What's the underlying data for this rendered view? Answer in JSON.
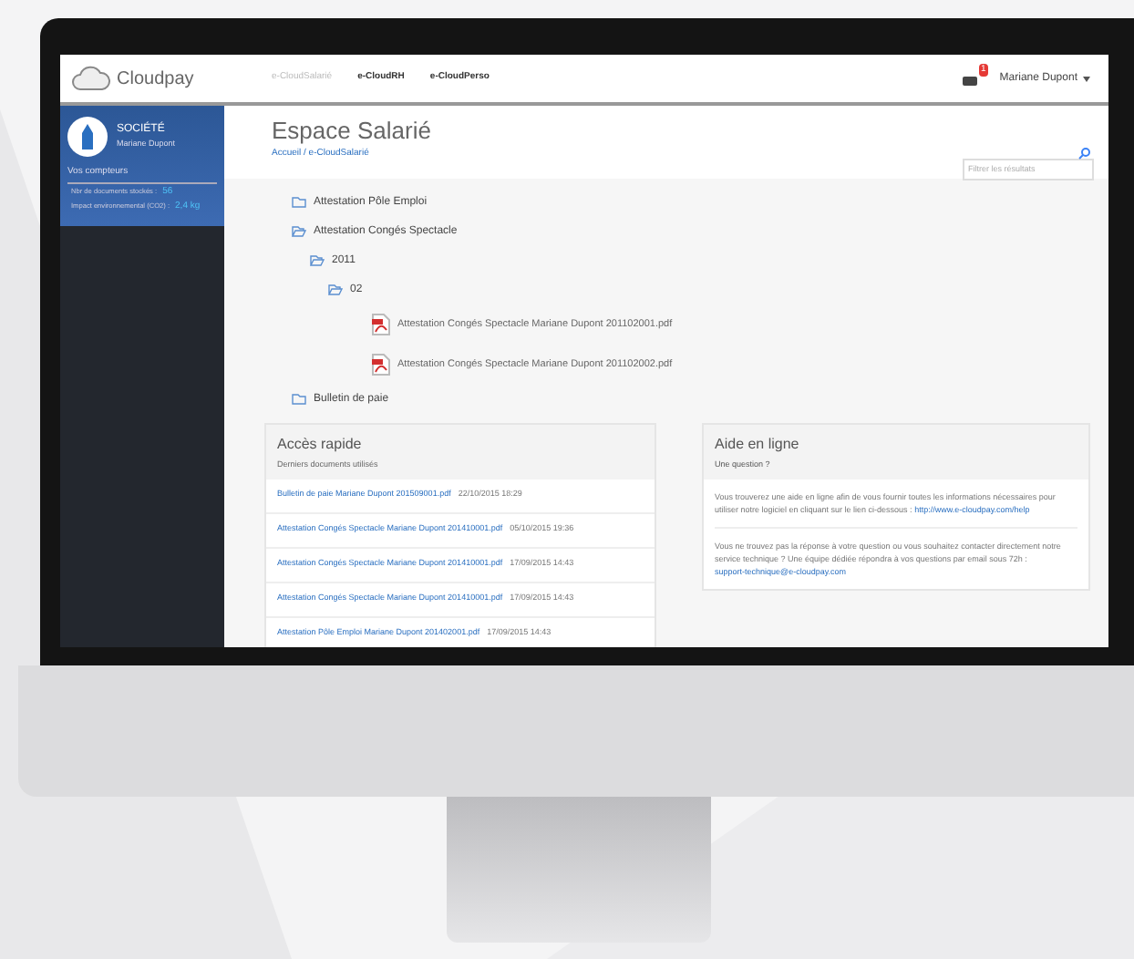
{
  "topbar": {
    "logo": "Cloudpay",
    "nav": [
      {
        "label": "e-CloudSalarié",
        "selected": true
      },
      {
        "label": "e-CloudRH",
        "selected": false
      },
      {
        "label": "e-CloudPerso",
        "selected": false
      }
    ],
    "notifications": "1",
    "user": "Mariane Dupont"
  },
  "sidebar": {
    "company": "SOCIÉTÉ",
    "user": "Mariane Dupont",
    "counters_title": "Vos compteurs",
    "counters": [
      {
        "label": "Nbr de documents stockés :",
        "value": "56"
      },
      {
        "label": "Impact environnemental (CO2) :",
        "value": "2,4 kg"
      }
    ]
  },
  "header": {
    "title": "Espace Salarié",
    "breadcrumb": "Accueil / e-CloudSalarié",
    "filter_placeholder": "Filtrer les résultats"
  },
  "tree": [
    {
      "kind": "folder",
      "label": "Attestation Pôle Emploi",
      "expanded": false
    },
    {
      "kind": "folder",
      "label": "Attestation Congés Spectacle",
      "expanded": true,
      "children": [
        {
          "kind": "folder",
          "label": "2011",
          "expanded": true,
          "children": [
            {
              "kind": "folder",
              "label": "02",
              "expanded": true,
              "children": [
                {
                  "kind": "file",
                  "label": "Attestation Congés Spectacle Mariane Dupont 201102001.pdf"
                },
                {
                  "kind": "file",
                  "label": "Attestation Congés Spectacle Mariane Dupont 201102002.pdf"
                }
              ]
            }
          ]
        }
      ]
    },
    {
      "kind": "folder",
      "label": "Bulletin de paie",
      "expanded": false
    }
  ],
  "quick_access": {
    "title": "Accès rapide",
    "subtitle": "Derniers documents utilisés",
    "rows": [
      {
        "file": "Bulletin de paie Mariane Dupont 201509001.pdf",
        "date": "22/10/2015 18:29"
      },
      {
        "file": "Attestation Congés Spectacle Mariane Dupont 201410001.pdf",
        "date": "05/10/2015 19:36"
      },
      {
        "file": "Attestation Congés Spectacle Mariane Dupont 201410001.pdf",
        "date": "17/09/2015 14:43"
      },
      {
        "file": "Attestation Congés Spectacle Mariane Dupont 201410001.pdf",
        "date": "17/09/2015 14:43"
      },
      {
        "file": "Attestation Pôle Emploi Mariane Dupont 201402001.pdf",
        "date": "17/09/2015 14:43"
      }
    ]
  },
  "help": {
    "title": "Aide en ligne",
    "subtitle": "Une question ?",
    "paragraphs": [
      {
        "text": "Vous trouverez une aide en ligne afin de vous fournir toutes les informations nécessaires pour utiliser notre logiciel en cliquant sur le lien ci-dessous :",
        "link": "http://www.e-cloudpay.com/help"
      },
      {
        "text": "Vous ne trouvez pas la réponse à votre question ou vous souhaitez contacter directement notre service technique ? Une équipe dédiée répondra à vos questions par email sous 72h :",
        "link": "support-technique@e-cloudpay.com"
      }
    ]
  }
}
